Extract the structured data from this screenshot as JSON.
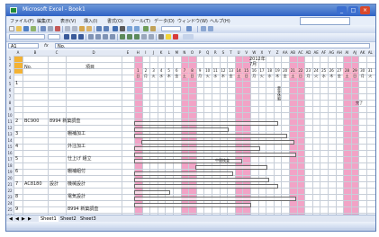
{
  "window": {
    "title": "Microsoft Excel - Book1",
    "min": "_",
    "max": "□",
    "close": "×"
  },
  "menu": [
    "ファイル(F)",
    "編集(E)",
    "表示(V)",
    "挿入(I)",
    "書式(O)",
    "ツール(T)",
    "データ(D)",
    "ウィンドウ(W)",
    "ヘルプ(H)"
  ],
  "formula": {
    "name_box": "A1",
    "fx": "fx",
    "value": "No."
  },
  "header": {
    "no": "No.",
    "item": "項目",
    "month_label": "7月",
    "year_label": "2012年"
  },
  "days": [
    "1",
    "2",
    "3",
    "4",
    "5",
    "6",
    "7",
    "8",
    "9",
    "10",
    "11",
    "12",
    "13",
    "14",
    "15",
    "16",
    "17",
    "18",
    "19",
    "20",
    "21",
    "22",
    "23",
    "24",
    "25",
    "26",
    "27",
    "28",
    "29",
    "30",
    "31"
  ],
  "weekdays": [
    "日",
    "月",
    "火",
    "水",
    "木",
    "金",
    "土",
    "日",
    "月",
    "火",
    "水",
    "木",
    "金",
    "土",
    "日",
    "月",
    "火",
    "水",
    "木",
    "金",
    "土",
    "日",
    "月",
    "火",
    "水",
    "木",
    "金",
    "土",
    "日",
    "月",
    "火"
  ],
  "rows": [
    {
      "no": "1",
      "code": "",
      "name": "",
      "detail": ""
    },
    {
      "no": "2",
      "code": "BC900",
      "name": "8994 新築調査",
      "detail": ""
    },
    {
      "no": "3",
      "code": "",
      "name": "",
      "detail": "棚補加工"
    },
    {
      "no": "4",
      "code": "",
      "name": "",
      "detail": "外注加工"
    },
    {
      "no": "5",
      "code": "",
      "name": "",
      "detail": "仕上げ 組立"
    },
    {
      "no": "6",
      "code": "",
      "name": "",
      "detail": "棚補組付"
    },
    {
      "no": "7",
      "code": "AC8180",
      "name": "設計",
      "detail": "機械設計"
    },
    {
      "no": "8",
      "code": "",
      "name": "",
      "detail": "電気設計"
    },
    {
      "no": "9",
      "code": "",
      "name": "",
      "detail": "8994 新築調査"
    },
    {
      "no": "10",
      "code": "",
      "name": "",
      "detail": "棚補加工"
    }
  ],
  "annotations": {
    "vertical_note": "夏季休暇",
    "side_note": "完了",
    "bar_label": "中間検査"
  },
  "sheets": [
    "Sheet1",
    "Sheet2",
    "Sheet3"
  ],
  "colors": {
    "pink": "#f2a3c6",
    "orange": "#f3b234",
    "title_blue": "#2f63c6"
  }
}
